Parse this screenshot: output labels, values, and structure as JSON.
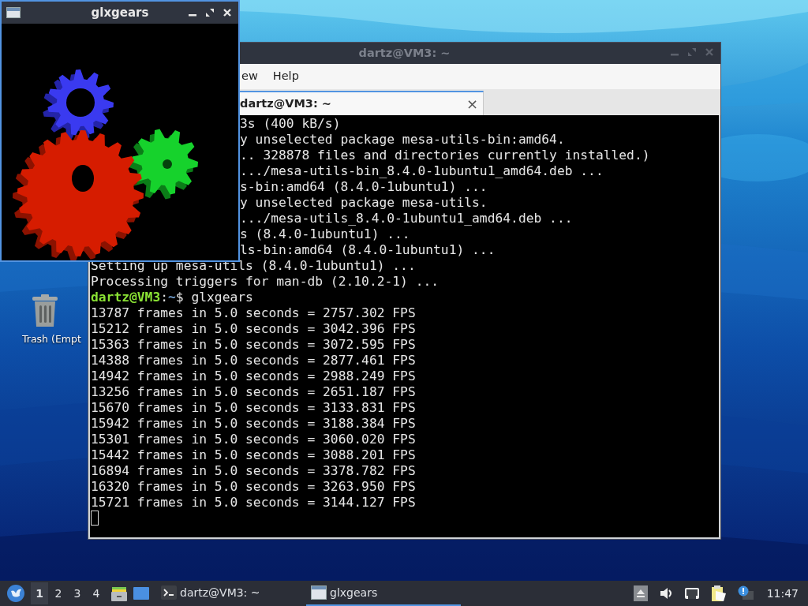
{
  "desktop": {
    "icons": [
      {
        "label": "Trash (Empt",
        "kind": "trash"
      }
    ]
  },
  "terminal_window": {
    "title": "dartz@VM3: ~",
    "active": false,
    "menu": [
      "ew",
      "Help"
    ],
    "tabs": [
      {
        "label": "dartz@VM3: ~",
        "selected": true,
        "close": "×"
      }
    ],
    "output": {
      "partly_hidden_lines": [
        "3s (400 kB/s)",
        "y unselected package mesa-utils-bin:amd64.",
        ".. 328878 files and directories currently installed.)",
        ".../mesa-utils-bin_8.4.0-1ubuntu1_amd64.deb ...",
        "s-bin:amd64 (8.4.0-1ubuntu1) ...",
        "y unselected package mesa-utils.",
        ".../mesa-utils_8.4.0-1ubuntu1_amd64.deb ...",
        "s (8.4.0-1ubuntu1) ...",
        "ls-bin:amd64 (8.4.0-1ubuntu1) ..."
      ],
      "lines": [
        "Setting up mesa-utils (8.4.0-1ubuntu1) ...",
        "Processing triggers for man-db (2.10.2-1) ..."
      ],
      "prompt": {
        "user_host": "dartz@VM3",
        "separator": ":",
        "path": "~",
        "command": "$ glxgears"
      },
      "fps_lines": [
        "13787 frames in 5.0 seconds = 2757.302 FPS",
        "15212 frames in 5.0 seconds = 3042.396 FPS",
        "15363 frames in 5.0 seconds = 3072.595 FPS",
        "14388 frames in 5.0 seconds = 2877.461 FPS",
        "14942 frames in 5.0 seconds = 2988.249 FPS",
        "13256 frames in 5.0 seconds = 2651.187 FPS",
        "15670 frames in 5.0 seconds = 3133.831 FPS",
        "15942 frames in 5.0 seconds = 3188.384 FPS",
        "15301 frames in 5.0 seconds = 3060.020 FPS",
        "15442 frames in 5.0 seconds = 3088.201 FPS",
        "16894 frames in 5.0 seconds = 3378.782 FPS",
        "16320 frames in 5.0 seconds = 3263.950 FPS",
        "15721 frames in 5.0 seconds = 3144.127 FPS"
      ]
    }
  },
  "glxgears_window": {
    "title": "glxgears",
    "active": true
  },
  "taskbar": {
    "workspaces": [
      {
        "label": "1",
        "selected": true
      },
      {
        "label": "2",
        "selected": false
      },
      {
        "label": "3",
        "selected": false
      },
      {
        "label": "4",
        "selected": false
      }
    ],
    "tasks": [
      {
        "label": "dartz@VM3: ~",
        "kind": "terminal",
        "selected": false
      },
      {
        "label": "glxgears",
        "kind": "window",
        "selected": true
      }
    ],
    "clock": "11:47"
  }
}
